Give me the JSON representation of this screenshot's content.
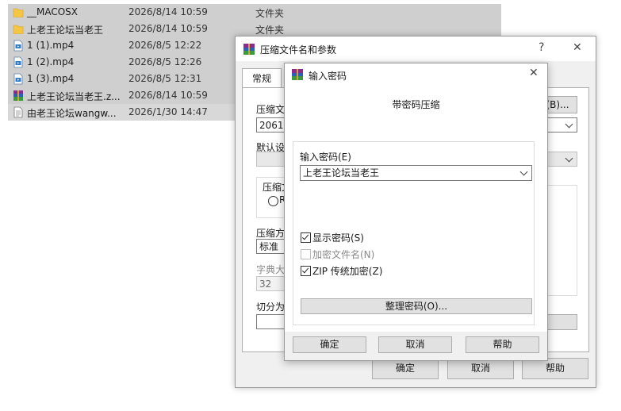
{
  "files": [
    {
      "name": "__MACOSX",
      "date": "2026/8/14 10:59",
      "type": "文件夹",
      "icon": "folder-icon"
    },
    {
      "name": "上老王论坛当老王",
      "date": "2026/8/14 10:59",
      "type": "文件夹",
      "icon": "folder-icon"
    },
    {
      "name": "1 (1).mp4",
      "date": "2026/8/5 12:22",
      "type": "",
      "icon": "video-file-icon"
    },
    {
      "name": "1 (2).mp4",
      "date": "2026/8/5 12:26",
      "type": "",
      "icon": "video-file-icon"
    },
    {
      "name": "1 (3).mp4",
      "date": "2026/8/5 12:31",
      "type": "",
      "icon": "video-file-icon"
    },
    {
      "name": "上老王论坛当老王.z...",
      "date": "2026/8/14 10:59",
      "type": "",
      "icon": "winrar-archive-icon"
    },
    {
      "name": "由老王论坛wangw...",
      "date": "2026/1/30 14:47",
      "type": "",
      "icon": "text-file-icon"
    }
  ],
  "archive_dialog": {
    "title": "压缩文件名和参数",
    "help_glyph": "?",
    "close_glyph": "✕",
    "tab_general": "常规",
    "archive_name_label": "压缩文",
    "archive_name_value": "2061.z",
    "browse_label": "(B)...",
    "default_settings_label": "默认设",
    "format_label": "压缩文",
    "radio_label": "R",
    "method_label": "压缩方",
    "method_value": "标准",
    "dict_label": "字典大",
    "dict_value": "32",
    "split_label": "切分为",
    "ok": "确定",
    "cancel": "取消",
    "help": "帮助"
  },
  "password_dialog": {
    "title": "输入密码",
    "close_glyph": "✕",
    "heading": "带密码压缩",
    "enter_label": "输入密码(E)",
    "password_value": "上老王论坛当老王",
    "show_password": "显示密码(S)",
    "show_password_checked": true,
    "encrypt_names": "加密文件名(N)",
    "encrypt_names_checked": false,
    "zip_legacy": "ZIP 传统加密(Z)",
    "zip_legacy_checked": true,
    "organize": "整理密码(O)...",
    "ok": "确定",
    "cancel": "取消",
    "help": "帮助"
  },
  "colors": {
    "selection": "#cfcfcf",
    "dialog_bg": "#f0f0f0",
    "folder": "#f5c544",
    "file_icon_blue": "#2f7fd0"
  }
}
